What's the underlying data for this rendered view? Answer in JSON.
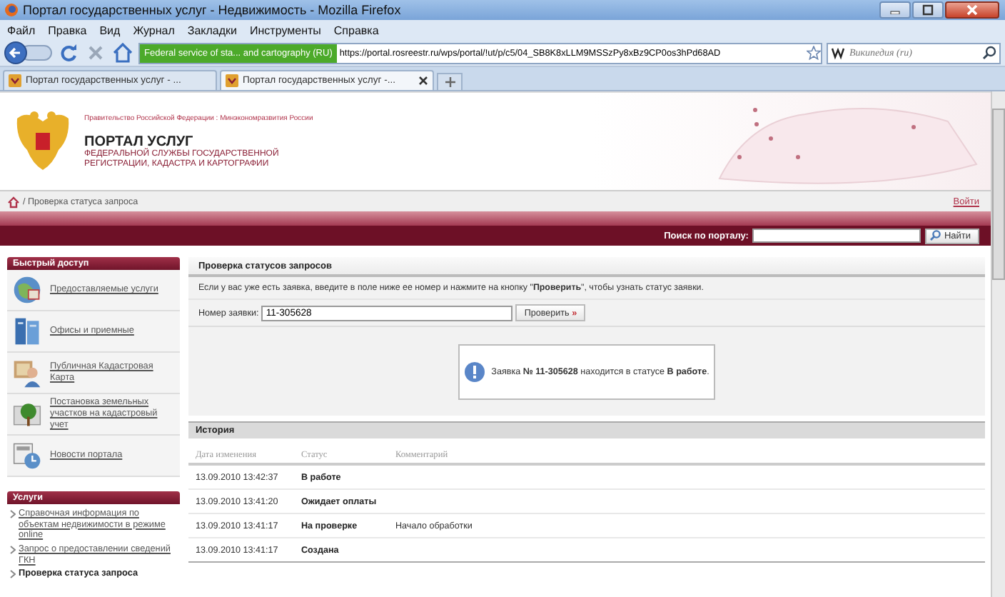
{
  "window": {
    "title": "Портал государственных услуг - Недвижимость - Mozilla Firefox"
  },
  "menu": [
    "Файл",
    "Правка",
    "Вид",
    "Журнал",
    "Закладки",
    "Инструменты",
    "Справка"
  ],
  "navbar": {
    "site_identity": "Federal service of sta... and cartography (RU)",
    "url": "https://portal.rosreestr.ru/wps/portal/!ut/p/c5/04_SB8K8xLLM9MSSzPy8xBz9CP0os3hPd68AD",
    "search_placeholder": "Википедия (ru)"
  },
  "tabs": [
    {
      "label": "Портал государственных услуг - ...",
      "selected": false
    },
    {
      "label": "Портал государственных услуг -...",
      "selected": true
    }
  ],
  "header": {
    "gov_line": "Правительство Российской Федерации : Минэкономразвития России",
    "title": "ПОРТАЛ УСЛУГ",
    "subtitle_1": "ФЕДЕРАЛЬНОЙ СЛУЖБЫ ГОСУДАРСТВЕННОЙ",
    "subtitle_2": "РЕГИСТРАЦИИ, КАДАСТРА И КАРТОГРАФИИ"
  },
  "breadcrumb": "/ Проверка статуса запроса",
  "login": "Войти",
  "search": {
    "label": "Поиск по порталу:",
    "button": "Найти"
  },
  "quick_access": {
    "title": "Быстрый доступ",
    "items": [
      {
        "label": "Предоставляемые услуги"
      },
      {
        "label": "Офисы и приемные"
      },
      {
        "label": "Публичная Кадастровая Карта"
      },
      {
        "label": "Постановка земельных участков на кадастровый учет"
      },
      {
        "label": "Новости портала"
      }
    ]
  },
  "services": {
    "title": "Услуги",
    "items": [
      {
        "label": "Справочная информация по объектам недвижимости в режиме online",
        "selected": false
      },
      {
        "label": "Запрос о предоставлении сведений ГКН",
        "selected": false
      },
      {
        "label": "Проверка статуса запроса",
        "selected": true
      }
    ]
  },
  "main": {
    "title": "Проверка статусов запросов",
    "intro": "Если у вас уже есть заявка, введите в поле ниже ее номер и нажмите на кнопку \"**Проверить**\", чтобы узнать статус заявки.",
    "field_label": "Номер заявки:",
    "field_value": "11-305628",
    "button": "Проверить",
    "button_arrow": "»",
    "message": "Заявка **№ 11-305628** находится в статусе **В работе**."
  },
  "history": {
    "title": "История",
    "columns": [
      "Дата изменения",
      "Статус",
      "Комментарий"
    ],
    "rows": [
      {
        "date": "13.09.2010 13:42:37",
        "status": "В работе"
      },
      {
        "date": "13.09.2010 13:41:20",
        "status": "Ожидает оплаты"
      },
      {
        "date": "13.09.2010 13:41:17",
        "status": "На проверке",
        "comment": "Начало обработки"
      },
      {
        "date": "13.09.2010 13:41:17",
        "status": "Создана"
      }
    ]
  }
}
